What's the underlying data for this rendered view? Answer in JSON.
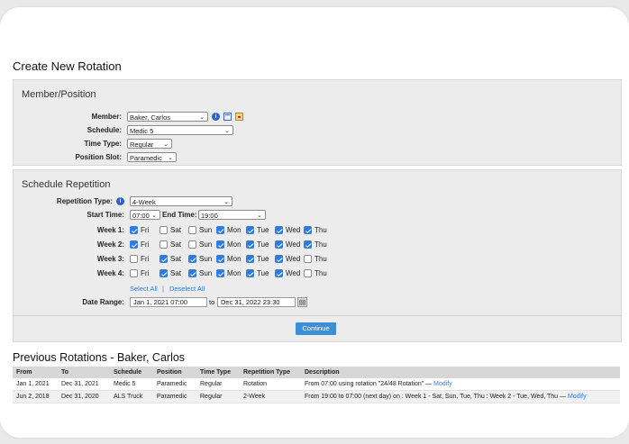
{
  "page": {
    "title": "Create New Rotation"
  },
  "member_position": {
    "section_title": "Member/Position",
    "member_label": "Member:",
    "member_value": "Baker, Carlos",
    "schedule_label": "Schedule:",
    "schedule_value": "Medic 5",
    "time_type_label": "Time Type:",
    "time_type_value": "Regular",
    "position_slot_label": "Position Slot:",
    "position_slot_value": "Paramedic"
  },
  "repetition": {
    "section_title": "Schedule Repetition",
    "repetition_type_label": "Repetition Type:",
    "repetition_type_value": "4-Week",
    "start_time_label": "Start Time:",
    "start_time_value": "07:00",
    "end_time_label": "End Time:",
    "end_time_value": "19:00",
    "days": [
      "Fri",
      "Sat",
      "Sun",
      "Mon",
      "Tue",
      "Wed",
      "Thu"
    ],
    "weeks": [
      {
        "label": "Week 1:",
        "checked": [
          true,
          false,
          false,
          true,
          true,
          true,
          true
        ]
      },
      {
        "label": "Week 2:",
        "checked": [
          true,
          false,
          false,
          true,
          true,
          true,
          true
        ]
      },
      {
        "label": "Week 3:",
        "checked": [
          false,
          true,
          true,
          true,
          true,
          true,
          false
        ]
      },
      {
        "label": "Week 4:",
        "checked": [
          false,
          true,
          true,
          true,
          true,
          true,
          false
        ]
      }
    ],
    "select_all": "Select All",
    "separator": "|",
    "deselect_all": "Deselect All",
    "date_range_label": "Date Range:",
    "date_from": "Jan 1, 2021 07:00",
    "date_to_label": "to",
    "date_to": "Dec 31, 2022 23:30"
  },
  "continue_label": "Continue",
  "previous": {
    "title": "Previous Rotations - Baker, Carlos",
    "headers": [
      "From",
      "To",
      "Schedule",
      "Position",
      "Time Type",
      "Repetition Type",
      "Description"
    ],
    "rows": [
      {
        "from": "Jan 1, 2021",
        "to": "Dec 31, 2021",
        "schedule": "Medic 5",
        "position": "Paramedic",
        "time_type": "Regular",
        "repetition_type": "Rotation",
        "description": "From 07:00 using rotation \"24/48 Rotation\" —",
        "modify": "Modify"
      },
      {
        "from": "Jun 2, 2018",
        "to": "Dec 31, 2020",
        "schedule": "ALS Truck",
        "position": "Paramedic",
        "time_type": "Regular",
        "repetition_type": "2-Week",
        "description": "From 19:00 to 07:00 (next day) on : Week 1 - Sat, Sun, Tue, Thu : Week 2 - Tue, Wed, Thu —",
        "modify": "Modify"
      }
    ]
  },
  "colors": {
    "accent": "#2f7de1",
    "panel_bg": "#ececec",
    "button": "#3d8fd6"
  },
  "icons": {
    "info": "info-icon",
    "calendar": "calendar-icon",
    "pdf": "pdf-icon",
    "date_picker": "date-picker-icon"
  }
}
